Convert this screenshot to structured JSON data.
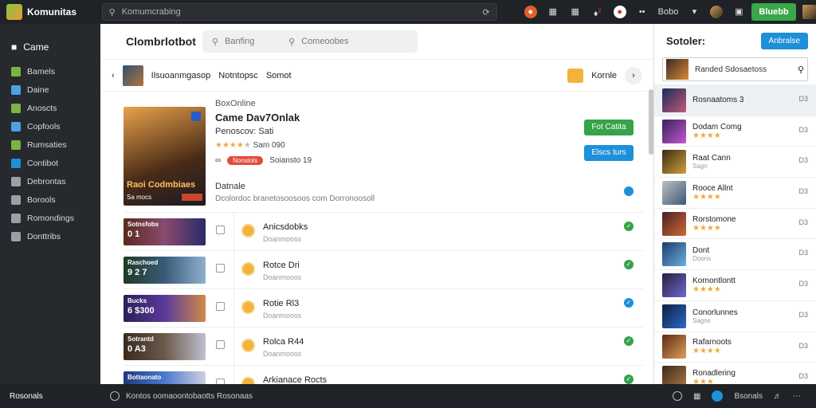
{
  "topbar": {
    "brand": "Komunitas",
    "search_text": "Komumcrabing",
    "user_label": "Bobo",
    "cta_label": "Bluebb",
    "notif_count": "2"
  },
  "sidebar": {
    "header": "Came",
    "items": [
      {
        "label": "Bamels",
        "color": "#7cb342"
      },
      {
        "label": "Daine",
        "color": "#4aa3df"
      },
      {
        "label": "Anoscts",
        "color": "#7cb342"
      },
      {
        "label": "Copfools",
        "color": "#4aa3df"
      },
      {
        "label": "Rumsaties",
        "color": "#7cb342"
      },
      {
        "label": "Contibot",
        "color": "#1e8fd9"
      },
      {
        "label": "Debrontas",
        "color": "#9aa0a6"
      },
      {
        "label": "Borools",
        "color": "#9aa0a6"
      },
      {
        "label": "Romondings",
        "color": "#9aa0a6"
      },
      {
        "label": "Donttribs",
        "color": "#9aa0a6"
      }
    ]
  },
  "main": {
    "title": "Clombrlotbot",
    "search1": "Banfing",
    "search2": "Comeoobes",
    "crumb": {
      "name": "Ilsuoanmgasop",
      "a": "Notntopsc",
      "b": "Somot",
      "right": "Kornle"
    },
    "section_label": "BoxOnline",
    "game": {
      "name": "Came Dav7Onlak",
      "sub": "Penoscov: Sati",
      "rating_text": "Sam 090",
      "tag": "Nonslots",
      "tag_text": "Soiansto 19",
      "cover_title": "Raoi Codmbiaes",
      "cover_sub": "Sa mocs"
    },
    "buttons": {
      "play": "Fot Catita",
      "secondary": "Elscs turs"
    },
    "desc": {
      "label": "Datnale",
      "text": "Dcolordoc branetosoosoos com Dorronoosoll"
    },
    "achievements": [
      {
        "thumb_a": "Sotnsfobs",
        "thumb_b": "0 1",
        "name": "Anicsdobks",
        "sub": "Doanmooss",
        "done": "green",
        "bg": "linear-gradient(90deg,#5b2a1e,#8a4a6e,#2b2a6a)"
      },
      {
        "thumb_a": "Raschoed",
        "thumb_b": "9 2 7",
        "name": "Rotce Dri",
        "sub": "Doanmooss",
        "done": "green",
        "bg": "linear-gradient(90deg,#1f3a24,#3a5a7a,#8fb0d0)"
      },
      {
        "thumb_a": "Bucks",
        "thumb_b": "6 $300",
        "name": "Rotie Rl3",
        "sub": "Doanmooss",
        "done": "blue",
        "bg": "linear-gradient(90deg,#2b1f5a,#5a3a9a,#d08a4a)"
      },
      {
        "thumb_a": "Sotrantd",
        "thumb_b": "0 A3",
        "name": "Rolca R44",
        "sub": "Doanmooss",
        "done": "green",
        "bg": "linear-gradient(90deg,#3a2a1e,#6a5a4a,#c0c0d0)"
      },
      {
        "thumb_a": "Bottaonato",
        "thumb_b": "",
        "name": "Arkianace Rocts",
        "sub": "",
        "done": "green",
        "bg": "linear-gradient(90deg,#1f3a7a,#4a7ad0,#d0d0e0)"
      }
    ]
  },
  "right": {
    "title": "Sotoler:",
    "button": "Anbralse",
    "search_text": "Randed Sdosaetoss",
    "items": [
      {
        "name": "Rosnaatoms 3",
        "sub": "",
        "num": "D3",
        "stars": 0,
        "bg": "linear-gradient(135deg,#1a2b5a,#c05a7a)",
        "sel": true
      },
      {
        "name": "Dodam Comg",
        "sub": "",
        "num": "D3",
        "stars": 4,
        "bg": "linear-gradient(135deg,#3a1f5a,#c05ad0)",
        "sel": false
      },
      {
        "name": "Raat Cann",
        "sub": "Sagn",
        "num": "D3",
        "stars": 0,
        "bg": "linear-gradient(135deg,#3a2a10,#d0a040)",
        "sel": false
      },
      {
        "name": "Rooce Allnt",
        "sub": "",
        "num": "D3",
        "stars": 4,
        "bg": "linear-gradient(135deg,#c0c0c0,#3a5a7a)",
        "sel": false
      },
      {
        "name": "Rorstomone",
        "sub": "",
        "num": "D3",
        "stars": 4,
        "bg": "linear-gradient(135deg,#4a1f1f,#d06a3a)",
        "sel": false
      },
      {
        "name": "Dont",
        "sub": "Doons",
        "num": "D3",
        "stars": 0,
        "bg": "linear-gradient(135deg,#1f3a6a,#6ab0e0)",
        "sel": false
      },
      {
        "name": "Kornontlontt",
        "sub": "",
        "num": "D3",
        "stars": 4,
        "bg": "linear-gradient(135deg,#2a1f3a,#6a6ad0)",
        "sel": false
      },
      {
        "name": "Conorlunnes",
        "sub": "Sagns",
        "num": "D3",
        "stars": 0,
        "bg": "linear-gradient(135deg,#0f1f3a,#2a6ad0)",
        "sel": false
      },
      {
        "name": "Rafarnoots",
        "sub": "",
        "num": "D3",
        "stars": 4,
        "bg": "linear-gradient(135deg,#5a2a10,#e0a060)",
        "sel": false
      },
      {
        "name": "Ronadlering",
        "sub": "",
        "num": "D3",
        "stars": 3,
        "bg": "linear-gradient(135deg,#3a2a1a,#b07a4a)",
        "sel": false
      }
    ]
  },
  "bottombar": {
    "left": "Rosonals",
    "status": "Kontos oomaoontobaotts Rosonaas",
    "right_label": "Bsonals"
  }
}
